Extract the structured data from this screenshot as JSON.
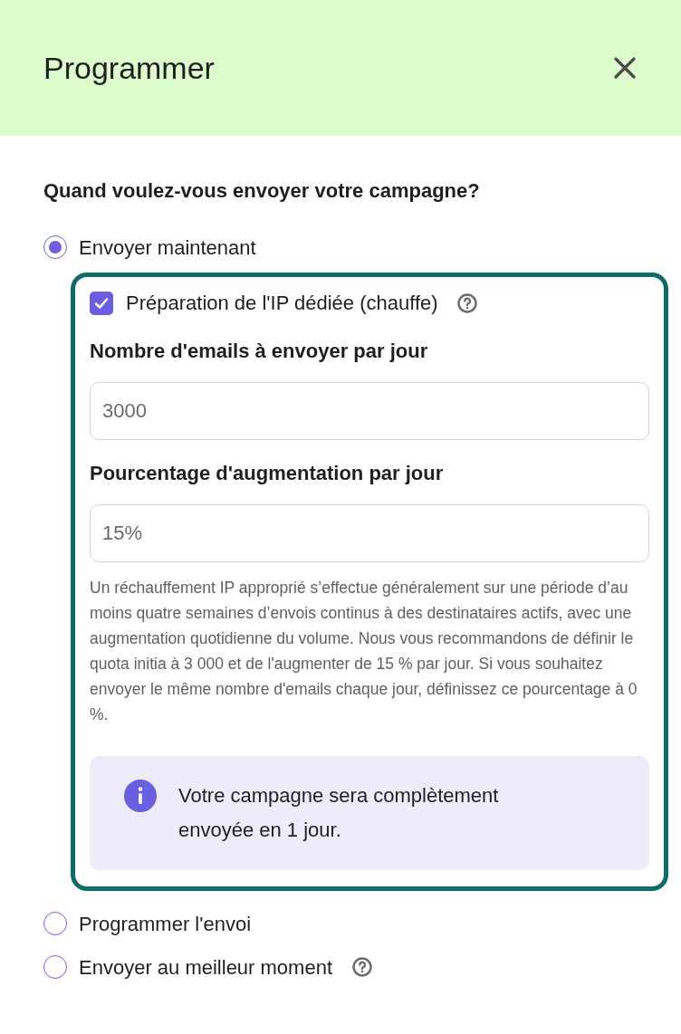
{
  "header": {
    "title": "Programmer"
  },
  "question": "Quand voulez-vous envoyer votre campagne?",
  "options": [
    {
      "label": "Envoyer maintenant",
      "selected": true,
      "help": false,
      "warmup": {
        "checkbox": {
          "label": "Préparation de l'IP dédiée (chauffe)",
          "checked": true,
          "help": true
        },
        "fields": [
          {
            "label": "Nombre d'emails à envoyer par jour",
            "value": "3000"
          },
          {
            "label": "Pourcentage d'augmentation par jour",
            "value": "15%"
          }
        ],
        "hint": "Un réchauffement IP approprié s’effectue généralement sur une période d’au moins quatre semaines d’envois continus à des destinataires actifs, avec une augmentation quotidienne du volume. Nous vous recommandons de définir le quota initia à 3 000 et de l'augmenter de 15 % par jour. Si vous souhaitez envoyer le même nombre d'emails chaque jour, définissez ce pourcentage à 0 %.",
        "info": "Votre campagne sera complètement envoyée en 1 jour."
      }
    },
    {
      "label": "Programmer l'envoi",
      "selected": false,
      "help": false
    },
    {
      "label": "Envoyer au meilleur moment",
      "selected": false,
      "help": true
    }
  ]
}
